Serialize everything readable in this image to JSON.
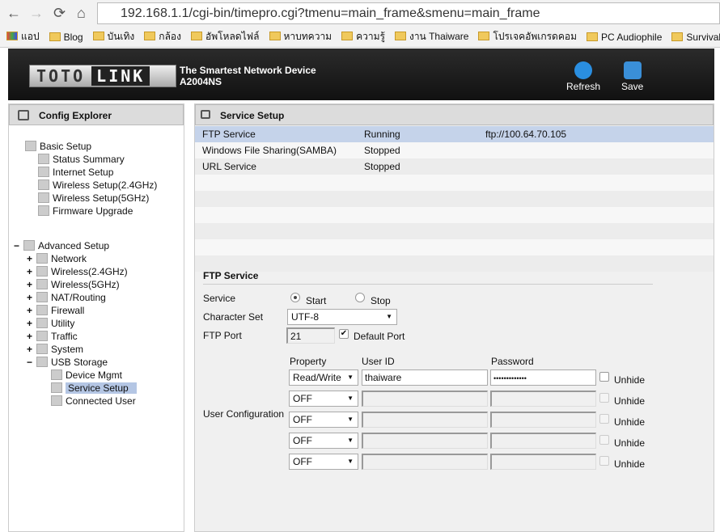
{
  "browser": {
    "url": "192.168.1.1/cgi-bin/timepro.cgi?tmenu=main_frame&smenu=main_frame",
    "bookmarks": [
      "แอป",
      "Blog",
      "บันเทิง",
      "กล้อง",
      "อัพโหลดไฟล์",
      "หาบทความ",
      "ความรู้",
      "งาน Thaiware",
      "โปรเจคอัพเกรดคอม",
      "PC Audiophile",
      "Survival kits"
    ]
  },
  "header": {
    "logo_left": "TOTO",
    "logo_right": "LINK",
    "tagline": "The Smartest Network Device",
    "model": "A2004NS",
    "refresh": "Refresh",
    "save": "Save"
  },
  "sidebar": {
    "title": "Config Explorer",
    "basic": {
      "label": "Basic Setup",
      "items": [
        "Status Summary",
        "Internet Setup",
        "Wireless Setup(2.4GHz)",
        "Wireless Setup(5GHz)",
        "Firmware Upgrade"
      ]
    },
    "advanced": {
      "label": "Advanced Setup",
      "items": [
        "Network",
        "Wireless(2.4GHz)",
        "Wireless(5GHz)",
        "NAT/Routing",
        "Firewall",
        "Utility",
        "Traffic",
        "System",
        "USB Storage"
      ],
      "usb_children": [
        "Device Mgmt",
        "Service Setup",
        "Connected User"
      ]
    }
  },
  "main": {
    "title": "Service Setup",
    "services": [
      {
        "name": "FTP Service",
        "status": "Running",
        "info": "ftp://100.64.70.105"
      },
      {
        "name": "Windows File Sharing(SAMBA)",
        "status": "Stopped",
        "info": ""
      },
      {
        "name": "URL Service",
        "status": "Stopped",
        "info": ""
      }
    ],
    "ftp": {
      "section": "FTP Service",
      "service_label": "Service",
      "start": "Start",
      "stop": "Stop",
      "service_value": "Start",
      "charset_label": "Character Set",
      "charset": "UTF-8",
      "port_label": "FTP Port",
      "port": "21",
      "default_port": "Default Port",
      "default_port_checked": true,
      "user_config_label": "User Configuration",
      "col_property": "Property",
      "col_user": "User ID",
      "col_password": "Password",
      "unhide": "Unhide",
      "users": [
        {
          "property": "Read/Write",
          "user": "thaiware",
          "password": "•••••••••••••"
        },
        {
          "property": "OFF",
          "user": "",
          "password": ""
        },
        {
          "property": "OFF",
          "user": "",
          "password": ""
        },
        {
          "property": "OFF",
          "user": "",
          "password": ""
        },
        {
          "property": "OFF",
          "user": "",
          "password": ""
        }
      ]
    }
  }
}
